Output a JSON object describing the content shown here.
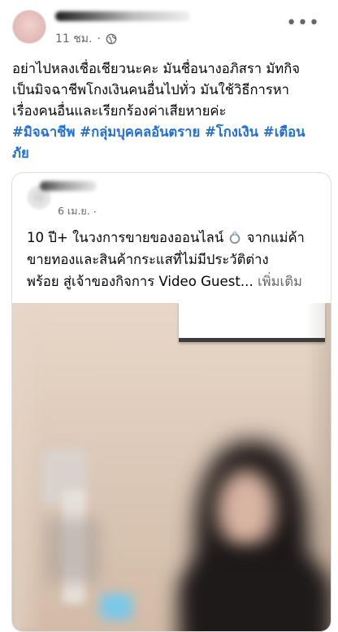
{
  "post": {
    "author_name": "",
    "time": "11 ชม.",
    "separator": "·",
    "privacy_icon": "globe-icon",
    "more_icon": "ellipsis-icon",
    "text_lines": [
      "อย่าไปหลงเชื่อเชียวนะคะ มันชื่อนางอภิสรา มัทกิจ",
      "เป็นมิจฉาชีพโกงเงินคนอื่นไปทั่ว มันใช้วิธีการหา",
      "เรื่องคนอื่นและเรียกร้องค่าเสียหายค่ะ"
    ],
    "hashtags_line1": "#มิจฉาชีพ #กลุ่มบุคคลอันตราย #โกงเงิน #เตือน",
    "hashtags_line2": "ภัย"
  },
  "shared_post": {
    "author_name": "",
    "date": "6 เม.ย.",
    "separator": "·",
    "text_line1_a": "10 ปี+ ในวงการขายของออนไลน์ ",
    "ring_icon": "ring-icon",
    "text_line1_b": " จากแม่ค้า",
    "text_line2": "ขายทองและสินค้ากระแสที่ไม่มีประวัติต่าง",
    "text_line3": "พร้อย สู่เจ้าของกิจการ Video Guest...",
    "see_more": " เพิ่มเติม"
  },
  "colors": {
    "hashtag": "#216fdb",
    "meta": "#65676b",
    "text": "#050505"
  }
}
